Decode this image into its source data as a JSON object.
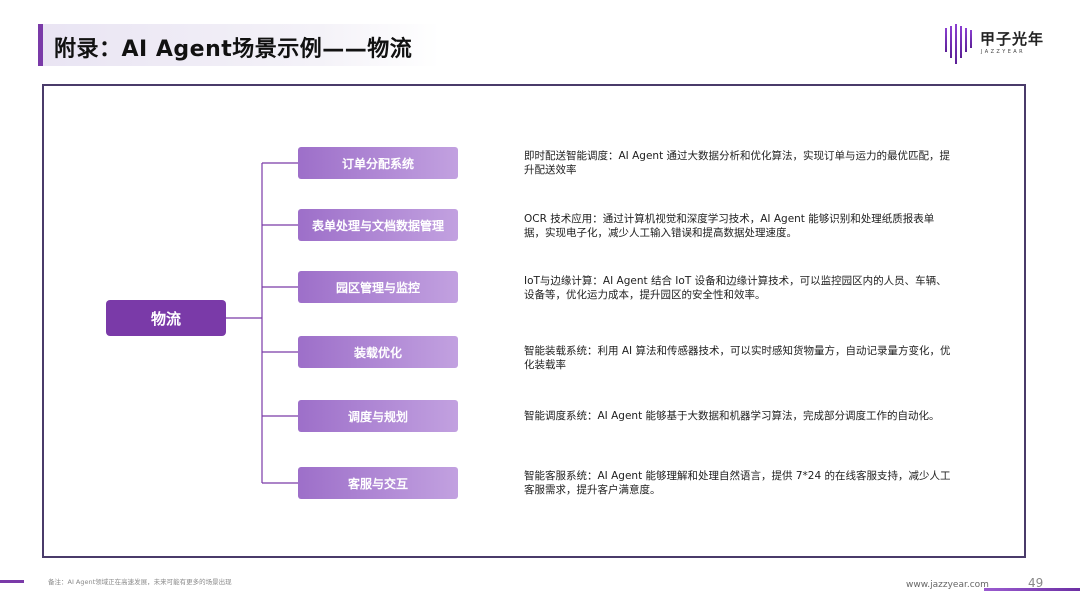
{
  "header": {
    "title": "附录：AI Agent场景示例——物流"
  },
  "logo": {
    "name_cn": "甲子光年",
    "name_en": "JAZZYEAR"
  },
  "diagram": {
    "hub_label": "物流",
    "branches": [
      {
        "label": "订单分配系统",
        "description": "即时配送智能调度：AI Agent 通过大数据分析和优化算法，实现订单与运力的最优匹配，提升配送效率"
      },
      {
        "label": "表单处理与文档数据管理",
        "description": "OCR 技术应用：通过计算机视觉和深度学习技术，AI Agent 能够识别和处理纸质报表单据，实现电子化，减少人工输入错误和提高数据处理速度。"
      },
      {
        "label": "园区管理与监控",
        "description": "IoT与边缘计算：AI Agent 结合 IoT 设备和边缘计算技术，可以监控园区内的人员、车辆、设备等，优化运力成本，提升园区的安全性和效率。"
      },
      {
        "label": "装载优化",
        "description": "智能装载系统：利用 AI 算法和传感器技术，可以实时感知货物量方，自动记录量方变化，优化装载率"
      },
      {
        "label": "调度与规划",
        "description": "智能调度系统：AI Agent 能够基于大数据和机器学习算法，完成部分调度工作的自动化。"
      },
      {
        "label": "客服与交互",
        "description": "智能客服系统：AI Agent 能够理解和处理自然语言，提供 7*24 的在线客服支持，减少人工客服需求，提升客户满意度。"
      }
    ]
  },
  "footer": {
    "note": "备注：AI Agent领域正在高速发展，未来可能有更多的场景出现",
    "url": "www.jazzyear.com",
    "page_number": "49"
  },
  "colors": {
    "accent": "#7a3aa8",
    "node_gradient_start": "#9d6fc9",
    "node_gradient_end": "#c2a1e0",
    "frame_border": "#4a3b6a"
  }
}
